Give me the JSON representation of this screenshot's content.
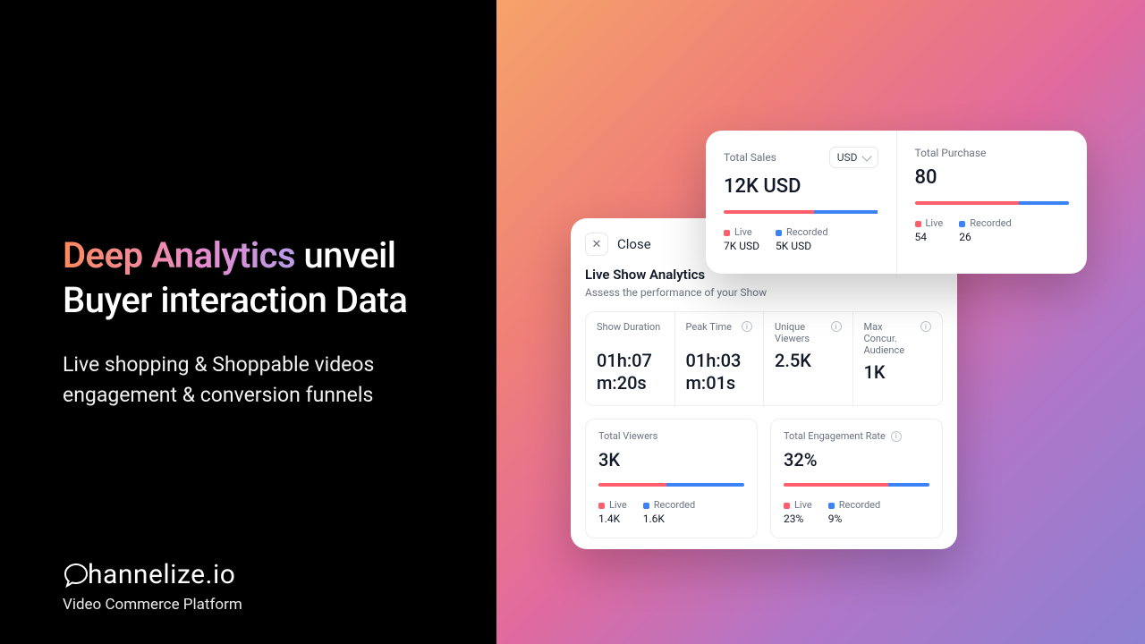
{
  "left": {
    "headline_grad": "Deep Analytics",
    "headline_rest1": " unveil",
    "headline_rest2": "Buyer interaction Data",
    "sub1": "Live shopping & Shoppable videos",
    "sub2": "engagement & conversion funnels",
    "brand_name": "hannelize.io",
    "brand_tag": "Video Commerce Platform"
  },
  "front": {
    "sales_label": "Total Sales",
    "currency": "USD",
    "sales_value": "12K USD",
    "sales_live_label": "Live",
    "sales_recorded_label": "Recorded",
    "sales_live_value": "7K USD",
    "sales_recorded_value": "5K USD",
    "purchase_label": "Total Purchase",
    "purchase_value": "80",
    "purchase_live_label": "Live",
    "purchase_recorded_label": "Recorded",
    "purchase_live_value": "54",
    "purchase_recorded_value": "26"
  },
  "back": {
    "close": "Close",
    "title": "Live Show Analytics",
    "subtitle": "Assess the performance of your Show",
    "m1_label": "Show Duration",
    "m1_value": "01h:07m:20s",
    "m2_label": "Peak Time",
    "m2_value": "01h:03m:01s",
    "m3_label": "Unique Viewers",
    "m3_value": "2.5K",
    "m4_label": "Max Concur. Audience",
    "m4_value": "1K",
    "tv_label": "Total Viewers",
    "tv_value": "3K",
    "tv_live_label": "Live",
    "tv_recorded_label": "Recorded",
    "tv_live_value": "1.4K",
    "tv_recorded_value": "1.6K",
    "er_label": "Total Engagement Rate",
    "er_value": "32%",
    "er_live_label": "Live",
    "er_recorded_label": "Recorded",
    "er_live_value": "23%",
    "er_recorded_value": "9%"
  },
  "chart_data": [
    {
      "type": "bar",
      "title": "Total Sales",
      "categories": [
        "Live",
        "Recorded"
      ],
      "values_label": [
        "7K USD",
        "5K USD"
      ],
      "values": [
        7,
        5
      ]
    },
    {
      "type": "bar",
      "title": "Total Purchase",
      "categories": [
        "Live",
        "Recorded"
      ],
      "values": [
        54,
        26
      ]
    },
    {
      "type": "bar",
      "title": "Total Viewers",
      "categories": [
        "Live",
        "Recorded"
      ],
      "values_label": [
        "1.4K",
        "1.6K"
      ],
      "values": [
        1400,
        1600
      ]
    },
    {
      "type": "bar",
      "title": "Total Engagement Rate",
      "categories": [
        "Live",
        "Recorded"
      ],
      "values_label": [
        "23%",
        "9%"
      ],
      "values": [
        23,
        9
      ]
    }
  ]
}
